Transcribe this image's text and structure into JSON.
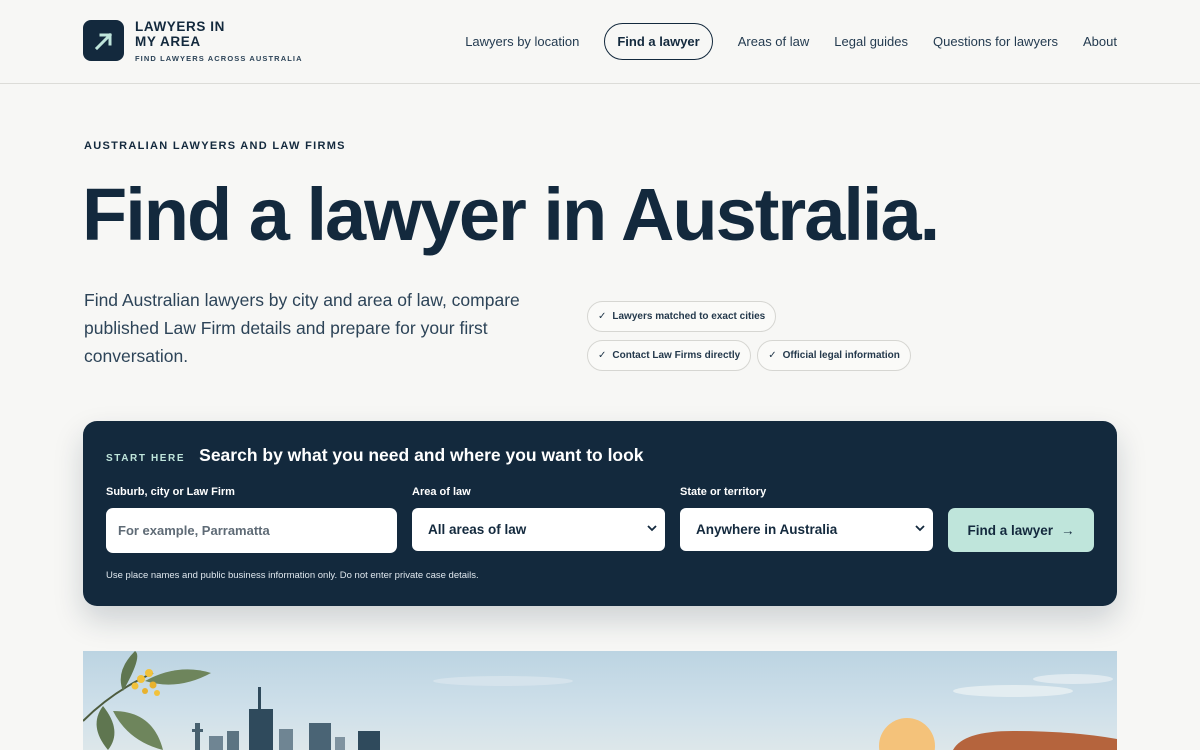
{
  "brand": {
    "name_line1": "LAWYERS IN",
    "name_line2": "MY AREA",
    "tagline": "FIND LAWYERS ACROSS AUSTRALIA",
    "logo_icon": "arrow-up-right-icon",
    "color": "#13293d"
  },
  "nav": {
    "items": [
      {
        "label": "Lawyers by location"
      },
      {
        "label": "Find a lawyer",
        "active": true
      },
      {
        "label": "Areas of law"
      },
      {
        "label": "Legal guides"
      },
      {
        "label": "Questions for lawyers"
      },
      {
        "label": "About"
      }
    ]
  },
  "hero": {
    "eyebrow": "AUSTRALIAN LAWYERS AND LAW FIRMS",
    "title": "Find a lawyer in Australia.",
    "description": "Find Australian lawyers by city and area of law, compare published Law Firm details and prepare for your first conversation.",
    "badges": [
      {
        "icon": "check-icon",
        "label": "Lawyers matched to exact cities"
      },
      {
        "icon": "check-icon",
        "label": "Contact Law Firms directly"
      },
      {
        "icon": "check-icon",
        "label": "Official legal information"
      }
    ]
  },
  "search": {
    "eyebrow": "START HERE",
    "title": "Search by what you need and where you want to look",
    "location_label": "Suburb, city or Law Firm",
    "location_placeholder": "For example, Parramatta",
    "location_value": "",
    "area_label": "Area of law",
    "area_value": "All areas of law",
    "state_label": "State or territory",
    "state_value": "Anywhere in Australia",
    "submit_label": "Find a lawyer",
    "submit_icon": "arrow-right-icon",
    "note": "Use place names and public business information only. Do not enter private case details."
  },
  "colors": {
    "navy": "#13293d",
    "accent": "#bfe5db",
    "page_bg": "#f7f7f5"
  }
}
